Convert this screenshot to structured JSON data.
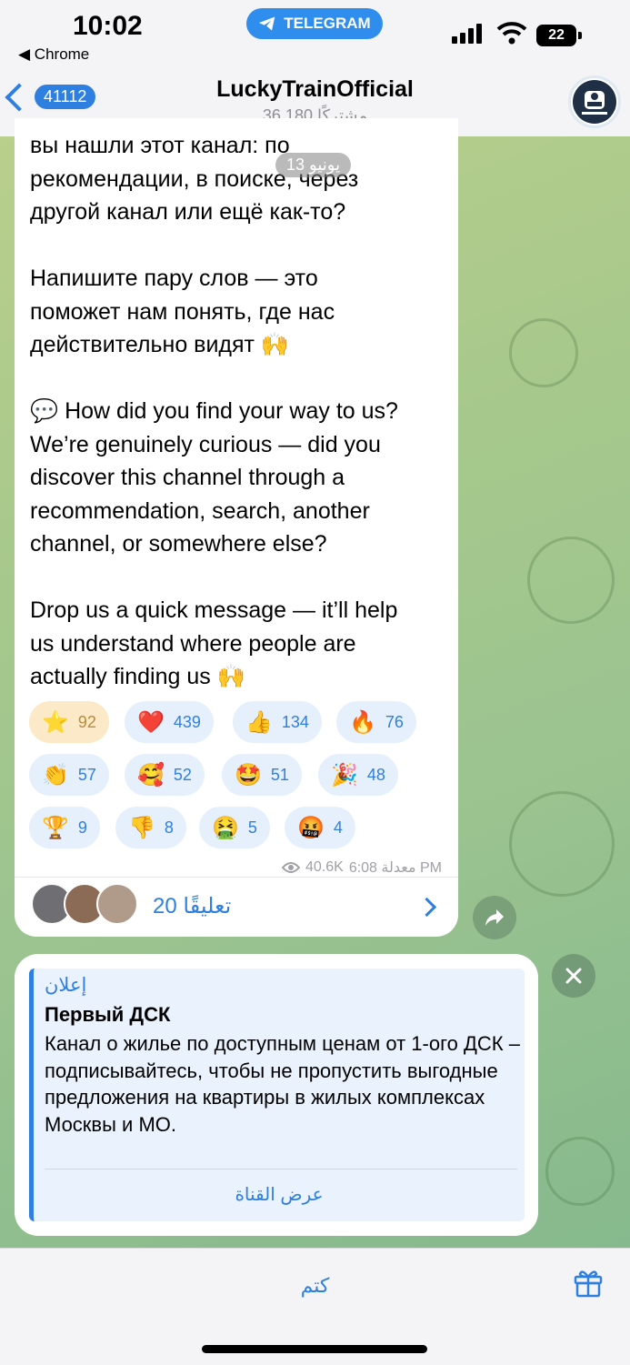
{
  "status_bar": {
    "time": "10:02",
    "back_app": "◀ Chrome",
    "pill_label": "TELEGRAM",
    "battery": "22"
  },
  "header": {
    "back_count": "41112",
    "title": "LuckyTrainOfficial",
    "subtitle": "36,180 مشتركًا",
    "avatar_icon": "train-icon"
  },
  "message": {
    "date": "13 يونيو",
    "text": "вы нашли этот канал: по\nрекомендации, в поиске, через\nдругой канал или ещё как-то?\n\nНапишите пару слов — это\nпоможет нам понять, где нас\nдействительно видят 🙌\n\n💬 How did you find your way to us?\nWe’re genuinely curious — did you\ndiscover this channel through a\nrecommendation, search, another\nchannel, or somewhere else?\n\nDrop us a quick message — it’ll help\nus understand where people are\nactually finding us 🙌",
    "reactions": [
      {
        "emoji": "⭐",
        "count": "92",
        "selected": true
      },
      {
        "emoji": "❤️",
        "count": "439"
      },
      {
        "emoji": "👍",
        "count": "134"
      },
      {
        "emoji": "🔥",
        "count": "76"
      },
      {
        "emoji": "👏",
        "count": "57"
      },
      {
        "emoji": "🥰",
        "count": "52"
      },
      {
        "emoji": "🤩",
        "count": "51"
      },
      {
        "emoji": "🎉",
        "count": "48"
      },
      {
        "emoji": "🏆",
        "count": "9"
      },
      {
        "emoji": "👎",
        "count": "8"
      },
      {
        "emoji": "🤮",
        "count": "5"
      },
      {
        "emoji": "🤬",
        "count": "4"
      }
    ],
    "views": "40.6K",
    "time": "معدلة 6:08 PM",
    "comments": "20 تعليقًا"
  },
  "ad": {
    "tag": "إعلان",
    "title": "Первый ДСК",
    "body": "Канал о жилье по доступным ценам от 1-ого ДСК – подписывайтесь, чтобы не пропустить выгодные предложения на квартиры в жилых комплексах Москвы и МО.",
    "action": "عرض القناة"
  },
  "bottom": {
    "mute": "كتم"
  },
  "colors": {
    "accent": "#2f7fe0",
    "chat_bg": "#a6c88c",
    "bubble": "#ffffff"
  }
}
